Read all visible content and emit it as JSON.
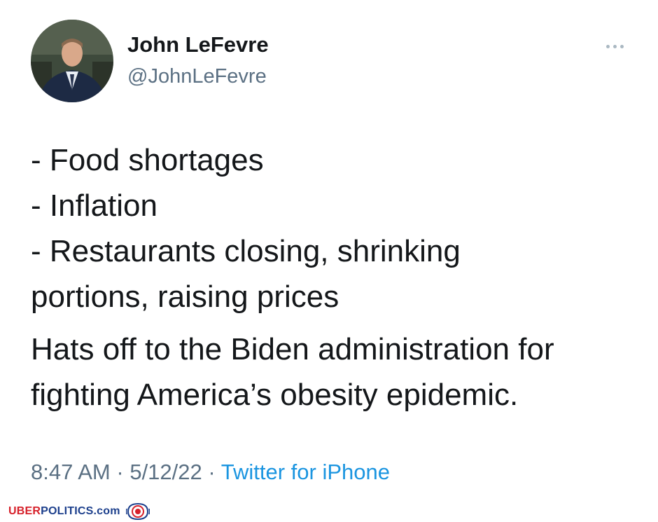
{
  "author": {
    "name": "John LeFevre",
    "handle": "@JohnLeFevre"
  },
  "icons": {
    "more": "more-horizontal-icon",
    "watermark_logo": "lion-seal-icon"
  },
  "tweet": {
    "list_lines": [
      "- Food shortages",
      "- Inflation",
      "- Restaurants closing, shrinking",
      "portions, raising prices"
    ],
    "body_lines": [
      "Hats off to the Biden administration for",
      "fighting America’s obesity epidemic."
    ]
  },
  "meta": {
    "time": "8:47 AM",
    "separator": "·",
    "date": "5/12/22",
    "source": "Twitter for iPhone"
  },
  "watermark": {
    "uber": "UBER",
    "politics": "POLITICS",
    "com": ".com"
  },
  "colors": {
    "text": "#14171a",
    "secondary": "#5b7083",
    "link": "#1b95e0",
    "watermark_red": "#d6202a",
    "watermark_blue": "#1c3f8c"
  }
}
